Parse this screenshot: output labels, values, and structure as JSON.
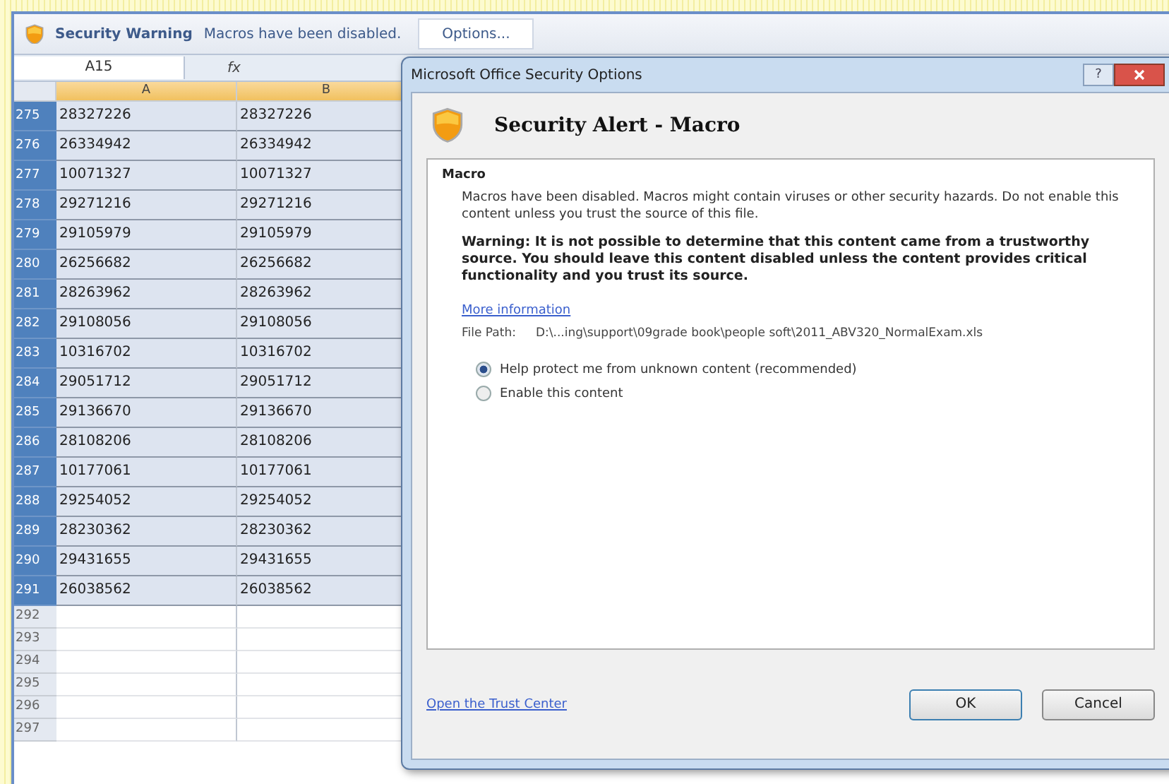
{
  "warning_bar": {
    "title": "Security Warning",
    "message": "Macros have been disabled.",
    "button": "Options..."
  },
  "formula_bar": {
    "name_box": "A15",
    "function_label": "fx"
  },
  "sheet": {
    "columns": [
      {
        "label": "A",
        "selected": true
      },
      {
        "label": "B",
        "selected": true
      }
    ],
    "rows": [
      {
        "number": "275",
        "cells": [
          "28327226",
          "28327226"
        ],
        "selected": true
      },
      {
        "number": "276",
        "cells": [
          "26334942",
          "26334942"
        ],
        "selected": true
      },
      {
        "number": "277",
        "cells": [
          "10071327",
          "10071327"
        ],
        "selected": true
      },
      {
        "number": "278",
        "cells": [
          "29271216",
          "29271216"
        ],
        "selected": true
      },
      {
        "number": "279",
        "cells": [
          "29105979",
          "29105979"
        ],
        "selected": true
      },
      {
        "number": "280",
        "cells": [
          "26256682",
          "26256682"
        ],
        "selected": true
      },
      {
        "number": "281",
        "cells": [
          "28263962",
          "28263962"
        ],
        "selected": true
      },
      {
        "number": "282",
        "cells": [
          "29108056",
          "29108056"
        ],
        "selected": true
      },
      {
        "number": "283",
        "cells": [
          "10316702",
          "10316702"
        ],
        "selected": true
      },
      {
        "number": "284",
        "cells": [
          "29051712",
          "29051712"
        ],
        "selected": true
      },
      {
        "number": "285",
        "cells": [
          "29136670",
          "29136670"
        ],
        "selected": true
      },
      {
        "number": "286",
        "cells": [
          "28108206",
          "28108206"
        ],
        "selected": true
      },
      {
        "number": "287",
        "cells": [
          "10177061",
          "10177061"
        ],
        "selected": true
      },
      {
        "number": "288",
        "cells": [
          "29254052",
          "29254052"
        ],
        "selected": true
      },
      {
        "number": "289",
        "cells": [
          "28230362",
          "28230362"
        ],
        "selected": true
      },
      {
        "number": "290",
        "cells": [
          "29431655",
          "29431655"
        ],
        "selected": true
      },
      {
        "number": "291",
        "cells": [
          "26038562",
          "26038562"
        ],
        "selected": true
      },
      {
        "number": "292",
        "cells": [],
        "selected": false
      },
      {
        "number": "293",
        "cells": [],
        "selected": false
      },
      {
        "number": "294",
        "cells": [],
        "selected": false
      },
      {
        "number": "295",
        "cells": [],
        "selected": false
      },
      {
        "number": "296",
        "cells": [],
        "selected": false
      },
      {
        "number": "297",
        "cells": [],
        "selected": false
      }
    ]
  },
  "dialog": {
    "title": "Microsoft Office Security Options",
    "help_button": "?",
    "heading": "Security Alert - Macro",
    "section": "Macro",
    "description": "Macros have been disabled. Macros might contain viruses or other security hazards. Do not enable this content unless you trust the source of this file.",
    "warning": "Warning: It is not possible to determine that this content came from a trustworthy source. You should leave this content disabled unless the content provides critical functionality and you trust its source.",
    "more_link": "More information",
    "file_path_label": "File Path:",
    "file_path": "D:\\...ing\\support\\09grade book\\people soft\\2011_ABV320_NormalExam.xls",
    "options": [
      {
        "label": "Help protect me from unknown content (recommended)",
        "selected": true
      },
      {
        "label": "Enable this content",
        "selected": false
      }
    ],
    "trust_link": "Open the Trust Center",
    "buttons": [
      "OK",
      "Cancel"
    ]
  }
}
